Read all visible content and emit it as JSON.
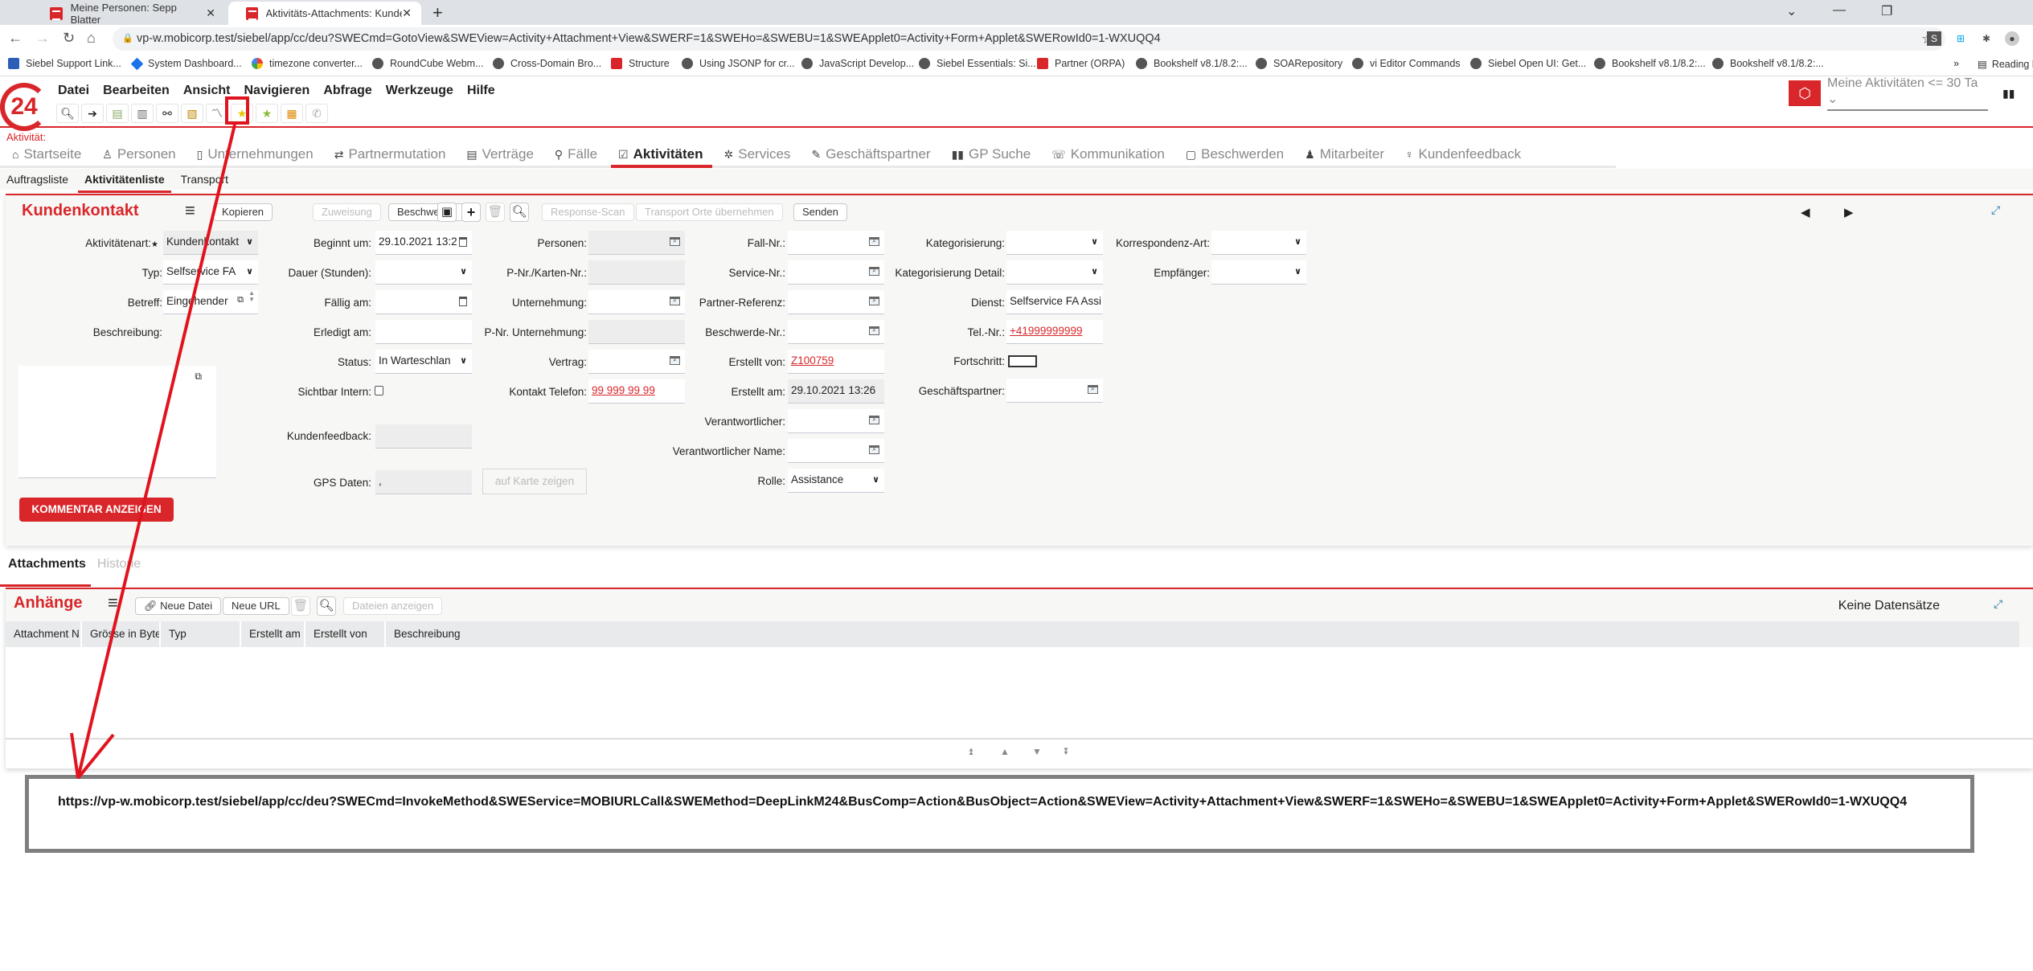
{
  "browser": {
    "tabs": [
      {
        "title": "Meine Personen: Sepp Blatter",
        "active": false
      },
      {
        "title": "Aktivitäts-Attachments: Kundenk",
        "active": true
      }
    ],
    "url": "vp-w.mobicorp.test/siebel/app/cc/deu?SWECmd=GotoView&SWEView=Activity+Attachment+View&SWERF=1&SWEHo=&SWEBU=1&SWEApplet0=Activity+Form+Applet&SWERowId0=1-WXUQQ4",
    "bookmarks": [
      {
        "label": "Siebel Support Link...",
        "icon": "x"
      },
      {
        "label": "System Dashboard...",
        "icon": "d"
      },
      {
        "label": "timezone converter...",
        "icon": "g"
      },
      {
        "label": "RoundCube Webm...",
        "icon": "globe"
      },
      {
        "label": "Cross-Domain Bro...",
        "icon": "globe"
      },
      {
        "label": "Structure",
        "icon": "m"
      },
      {
        "label": "Using JSONP for cr...",
        "icon": "globe"
      },
      {
        "label": "JavaScript Develop...",
        "icon": "globe"
      },
      {
        "label": "Siebel Essentials: Si...",
        "icon": "globe"
      },
      {
        "label": "Partner (ORPA)",
        "icon": "m"
      },
      {
        "label": "Bookshelf v8.1/8.2:...",
        "icon": "globe"
      },
      {
        "label": "SOARepository",
        "icon": "globe"
      },
      {
        "label": "vi Editor Commands",
        "icon": "globe"
      },
      {
        "label": "Siebel Open UI: Get...",
        "icon": "globe"
      },
      {
        "label": "Bookshelf v8.1/8.2:...",
        "icon": "globe"
      },
      {
        "label": "Bookshelf v8.1/8.2:...",
        "icon": "globe"
      }
    ],
    "bookmarks_overflow": "»",
    "reading_list": "Reading list"
  },
  "app": {
    "logo_text": "24",
    "menu": [
      "Datei",
      "Bearbeiten",
      "Ansicht",
      "Navigieren",
      "Abfrage",
      "Werkzeuge",
      "Hilfe"
    ],
    "toolbar_icons": [
      "search-icon",
      "go-icon",
      "clipboard-check-icon",
      "save-report-icon",
      "link-icon",
      "document-icon",
      "chart-icon",
      "favorite-star-icon",
      "add-favorite-icon",
      "org-icon",
      "phone-icon"
    ],
    "quick_search": {
      "value": "Meine Aktivitäten <= 30 Ta"
    },
    "context_label": "Aktivität:"
  },
  "screen_tabs": [
    {
      "label": "Startseite",
      "icon": "⌂",
      "active": false
    },
    {
      "label": "Personen",
      "icon": "♙",
      "active": false
    },
    {
      "label": "Unternehmungen",
      "icon": "▯",
      "active": false
    },
    {
      "label": "Partnermutation",
      "icon": "⇄",
      "active": false
    },
    {
      "label": "Verträge",
      "icon": "▤",
      "active": false
    },
    {
      "label": "Fälle",
      "icon": "⚲",
      "active": false
    },
    {
      "label": "Aktivitäten",
      "icon": "☑",
      "active": true
    },
    {
      "label": "Services",
      "icon": "✲",
      "active": false
    },
    {
      "label": "Geschäftspartner",
      "icon": "✎",
      "active": false
    },
    {
      "label": "GP Suche",
      "icon": "▮▮",
      "active": false
    },
    {
      "label": "Kommunikation",
      "icon": "☏",
      "active": false
    },
    {
      "label": "Beschwerden",
      "icon": "▢",
      "active": false
    },
    {
      "label": "Mitarbeiter",
      "icon": "♟",
      "active": false
    },
    {
      "label": "Kundenfeedback",
      "icon": "♀",
      "active": false
    }
  ],
  "view_tabs": [
    {
      "label": "Auftragsliste",
      "active": false
    },
    {
      "label": "Aktivitätenliste",
      "active": true
    },
    {
      "label": "Transport",
      "active": false
    }
  ],
  "form": {
    "title": "Kundenkontakt",
    "buttons": {
      "kopieren": "Kopieren",
      "zuweisung": "Zuweisung",
      "beschwerde": "Beschwerde",
      "response_scan": "Response-Scan",
      "transport": "Transport Orte übernehmen",
      "senden": "Senden"
    },
    "fields": {
      "aktivitaetenart": {
        "label": "Aktivitätenart:",
        "value": "Kundenkontakt",
        "required": "★"
      },
      "typ": {
        "label": "Typ:",
        "value": "Selfservice FA"
      },
      "betreff": {
        "label": "Betreff:",
        "value": "Eingehender"
      },
      "beschreibung": {
        "label": "Beschreibung:",
        "value": ""
      },
      "beginnt_um": {
        "label": "Beginnt um:",
        "value": "29.10.2021 13:2"
      },
      "dauer": {
        "label": "Dauer (Stunden):",
        "value": ""
      },
      "faellig_am": {
        "label": "Fällig am:",
        "value": ""
      },
      "erledigt_am": {
        "label": "Erledigt am:",
        "value": ""
      },
      "status": {
        "label": "Status:",
        "value": "In Warteschlan"
      },
      "sichtbar_intern": {
        "label": "Sichtbar Intern:",
        "checked": false
      },
      "kundenfeedback": {
        "label": "Kundenfeedback:",
        "value": ""
      },
      "gps_daten": {
        "label": "GPS Daten:",
        "value": ","
      },
      "auf_karte": "auf Karte zeigen",
      "personen": {
        "label": "Personen:",
        "value": ""
      },
      "pnr_karten": {
        "label": "P-Nr./Karten-Nr.:",
        "value": ""
      },
      "unternehmung": {
        "label": "Unternehmung:",
        "value": ""
      },
      "pnr_unternehmung": {
        "label": "P-Nr. Unternehmung:",
        "value": ""
      },
      "vertrag": {
        "label": "Vertrag:",
        "value": ""
      },
      "kontakt_telefon": {
        "label": "Kontakt Telefon:",
        "value": "99 999 99 99"
      },
      "fall_nr": {
        "label": "Fall-Nr.:",
        "value": ""
      },
      "service_nr": {
        "label": "Service-Nr.:",
        "value": ""
      },
      "partner_referenz": {
        "label": "Partner-Referenz:",
        "value": ""
      },
      "beschwerde_nr": {
        "label": "Beschwerde-Nr.:",
        "value": ""
      },
      "erstellt_von": {
        "label": "Erstellt von:",
        "value": "Z100759"
      },
      "erstellt_am": {
        "label": "Erstellt am:",
        "value": "29.10.2021  13:26"
      },
      "verantwortlicher": {
        "label": "Verantwortlicher:",
        "value": ""
      },
      "verantwortlicher_name": {
        "label": "Verantwortlicher Name:",
        "value": ""
      },
      "rolle": {
        "label": "Rolle:",
        "value": "Assistance"
      },
      "kategorisierung": {
        "label": "Kategorisierung:",
        "value": ""
      },
      "kategorisierung_detail": {
        "label": "Kategorisierung Detail:",
        "value": ""
      },
      "dienst": {
        "label": "Dienst:",
        "value": "Selfservice FA Assi"
      },
      "tel_nr": {
        "label": "Tel.-Nr.:",
        "value": "+41999999999"
      },
      "fortschritt": {
        "label": "Fortschritt:",
        "value": ""
      },
      "geschaeftspartner": {
        "label": "Geschäftspartner:",
        "value": ""
      },
      "korrespondenz_art": {
        "label": "Korrespondenz-Art:",
        "value": ""
      },
      "empfaenger": {
        "label": "Empfänger:",
        "value": ""
      }
    },
    "kommentar_button": "KOMMENTAR ANZEIGEN"
  },
  "bottom_tabs": [
    {
      "label": "Attachments",
      "active": true
    },
    {
      "label": "Historie",
      "active": false
    }
  ],
  "attachments": {
    "title": "Anhänge",
    "buttons": {
      "neue_datei": "Neue Datei",
      "neue_url": "Neue URL",
      "dateien_anzeigen": "Dateien anzeigen"
    },
    "columns": [
      "Attachment N",
      "Grösse in Bytes",
      "Typ",
      "Erstellt am",
      "Erstellt von",
      "Beschreibung"
    ],
    "rows": [],
    "record_status": "Keine Datensätze"
  },
  "annotation": {
    "deep_link_url": "https://vp-w.mobicorp.test/siebel/app/cc/deu?SWECmd=InvokeMethod&SWEService=MOBIURLCall&SWEMethod=DeepLinkM24&BusComp=Action&BusObject=Action&SWEView=Activity+Attachment+View&SWERF=1&SWEHo=&SWEBU=1&SWEApplet0=Activity+Form+Applet&SWERowId0=1-WXUQQ4",
    "color": "#e0141e"
  }
}
